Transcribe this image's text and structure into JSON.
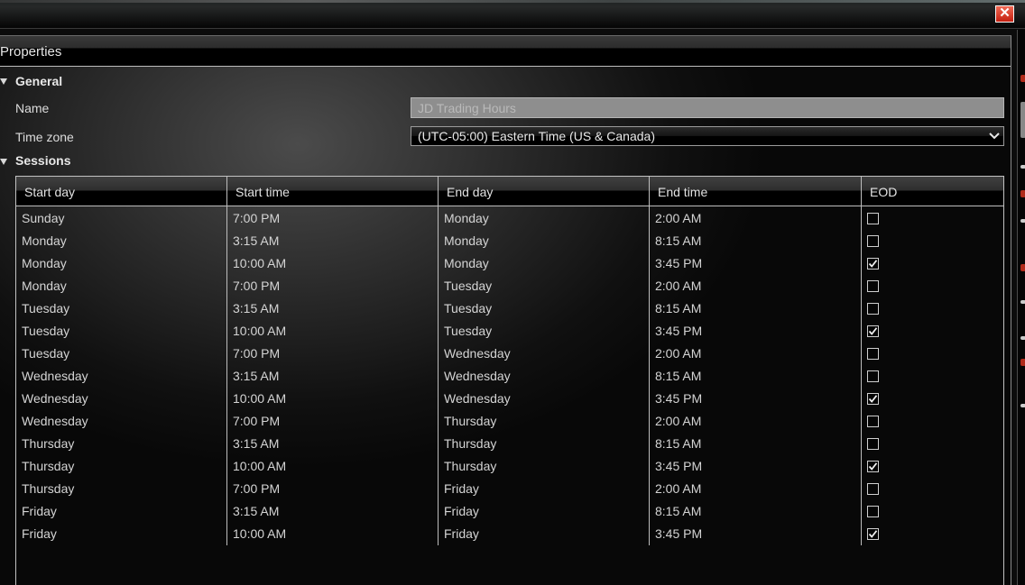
{
  "window": {
    "close_glyph": "✕"
  },
  "panel": {
    "title": "Properties"
  },
  "general": {
    "title": "General",
    "name_label": "Name",
    "name_value": "JD Trading Hours",
    "timezone_label": "Time zone",
    "timezone_value": "(UTC-05:00) Eastern Time (US & Canada)"
  },
  "sessions": {
    "title": "Sessions",
    "columns": [
      "Start day",
      "Start time",
      "End day",
      "End time",
      "EOD"
    ],
    "rows": [
      {
        "start_day": "Sunday",
        "start_time": "7:00 PM",
        "end_day": "Monday",
        "end_time": "2:00 AM",
        "eod": false
      },
      {
        "start_day": "Monday",
        "start_time": "3:15 AM",
        "end_day": "Monday",
        "end_time": "8:15 AM",
        "eod": false
      },
      {
        "start_day": "Monday",
        "start_time": "10:00 AM",
        "end_day": "Monday",
        "end_time": "3:45 PM",
        "eod": true
      },
      {
        "start_day": "Monday",
        "start_time": "7:00 PM",
        "end_day": "Tuesday",
        "end_time": "2:00 AM",
        "eod": false
      },
      {
        "start_day": "Tuesday",
        "start_time": "3:15 AM",
        "end_day": "Tuesday",
        "end_time": "8:15 AM",
        "eod": false
      },
      {
        "start_day": "Tuesday",
        "start_time": "10:00 AM",
        "end_day": "Tuesday",
        "end_time": "3:45 PM",
        "eod": true
      },
      {
        "start_day": "Tuesday",
        "start_time": "7:00 PM",
        "end_day": "Wednesday",
        "end_time": "2:00 AM",
        "eod": false
      },
      {
        "start_day": "Wednesday",
        "start_time": "3:15 AM",
        "end_day": "Wednesday",
        "end_time": "8:15 AM",
        "eod": false
      },
      {
        "start_day": "Wednesday",
        "start_time": "10:00 AM",
        "end_day": "Wednesday",
        "end_time": "3:45 PM",
        "eod": true
      },
      {
        "start_day": "Wednesday",
        "start_time": "7:00 PM",
        "end_day": "Thursday",
        "end_time": "2:00 AM",
        "eod": false
      },
      {
        "start_day": "Thursday",
        "start_time": "3:15 AM",
        "end_day": "Thursday",
        "end_time": "8:15 AM",
        "eod": false
      },
      {
        "start_day": "Thursday",
        "start_time": "10:00 AM",
        "end_day": "Thursday",
        "end_time": "3:45 PM",
        "eod": true
      },
      {
        "start_day": "Thursday",
        "start_time": "7:00 PM",
        "end_day": "Friday",
        "end_time": "2:00 AM",
        "eod": false
      },
      {
        "start_day": "Friday",
        "start_time": "3:15 AM",
        "end_day": "Friday",
        "end_time": "8:15 AM",
        "eod": false
      },
      {
        "start_day": "Friday",
        "start_time": "10:00 AM",
        "end_day": "Friday",
        "end_time": "3:45 PM",
        "eod": true
      }
    ]
  },
  "colors": {
    "close_button": "#d2311f",
    "panel_background": "#2a2a2a",
    "grid_border": "#c2c2c2",
    "accent_strip": [
      "#b02a1a",
      "#e0e0e0",
      "#b02a1a",
      "#e0e0e0"
    ]
  }
}
